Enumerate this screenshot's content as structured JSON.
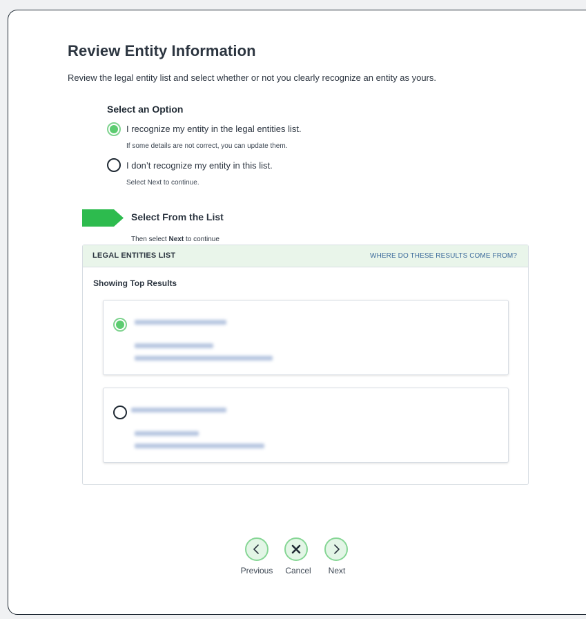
{
  "page": {
    "title": "Review Entity Information",
    "description": "Review the legal entity list and select whether or not you clearly recognize an entity as yours."
  },
  "options": {
    "heading": "Select an Option",
    "items": [
      {
        "label": "I recognize my entity in the legal entities list.",
        "hint": "If some details are not correct, you can update them.",
        "selected": true
      },
      {
        "label": "I don’t recognize my entity in this list.",
        "hint": "Select Next to continue.",
        "selected": false
      }
    ]
  },
  "step": {
    "title": "Select From the List",
    "hint_prefix": "Then select ",
    "hint_bold": "Next",
    "hint_suffix": " to continue"
  },
  "entities_list": {
    "header_title": "LEGAL ENTITIES LIST",
    "header_link": "WHERE DO THESE RESULTS COME FROM?",
    "showing_label": "Showing Top Results",
    "results": [
      {
        "selected": true
      },
      {
        "selected": false
      }
    ]
  },
  "nav": {
    "previous_label": "Previous",
    "cancel_label": "Cancel",
    "next_label": "Next"
  },
  "colors": {
    "accent_green": "#5ccc70",
    "step_arrow": "#2dbb4e",
    "header_bg": "#e9f5ea",
    "link": "#3c6a9b"
  },
  "icons": {
    "previous": "chevron-left-icon",
    "cancel": "close-icon",
    "next": "chevron-right-icon",
    "step": "step-arrow-icon"
  }
}
